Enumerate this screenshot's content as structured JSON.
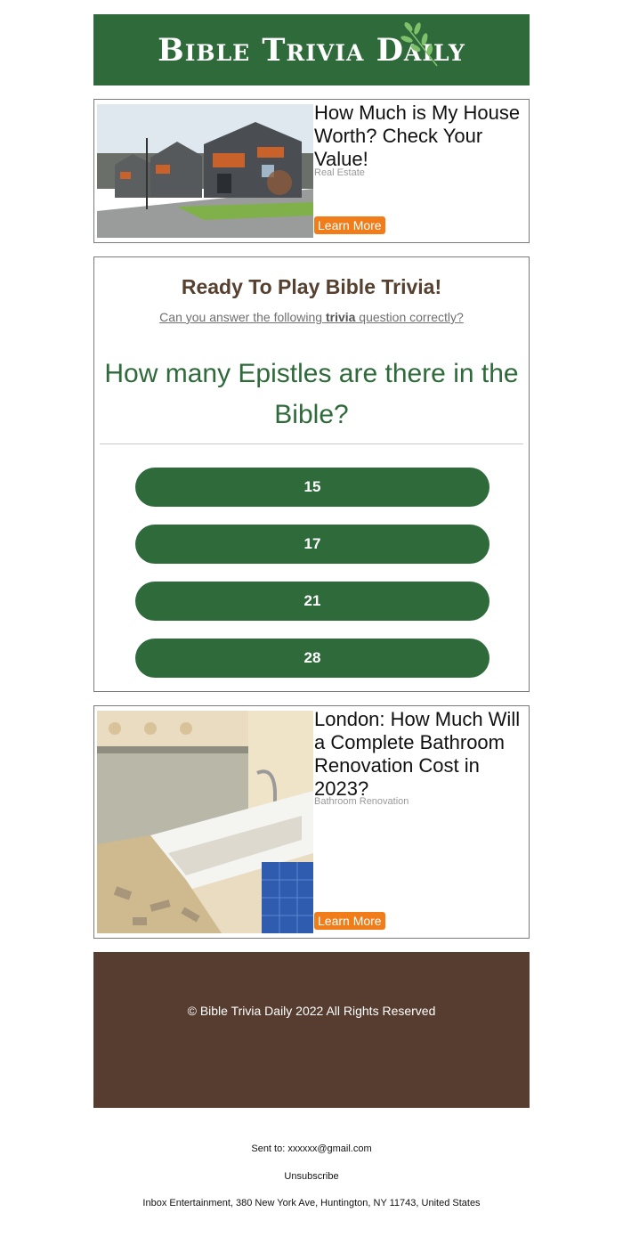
{
  "header": {
    "brand": "Bible Trivia Daily"
  },
  "ads": [
    {
      "title": "How Much is My House Worth? Check Your Value!",
      "category": "Real Estate",
      "cta": "Learn More",
      "image": "house-photo"
    },
    {
      "title": " London: How Much Will a Complete Bathroom Renovation Cost in 2023?",
      "category": "Bathroom Renovation",
      "cta": "Learn More",
      "image": "bathroom-photo"
    }
  ],
  "trivia": {
    "title": "Ready To Play Bible Trivia!",
    "subtitle_pre": "Can you answer the following ",
    "subtitle_bold": "trivia",
    "subtitle_post": " question correctly?",
    "question": "How many Epistles are there in the Bible?",
    "answers": [
      "15",
      "17",
      "21",
      "28"
    ]
  },
  "footer": {
    "copyright": "© Bible Trivia Daily 2022 All Rights Reserved"
  },
  "meta": {
    "sent_to_label": "Sent to: ",
    "sent_to_email": "xxxxxx@gmail.com",
    "unsubscribe": "Unsubscribe",
    "address": "Inbox Entertainment, 380 New York Ave, Huntington, NY 11743, United States"
  },
  "colors": {
    "brand_green": "#2f6a3b",
    "brown": "#563d2f",
    "orange": "#f07c1a"
  }
}
